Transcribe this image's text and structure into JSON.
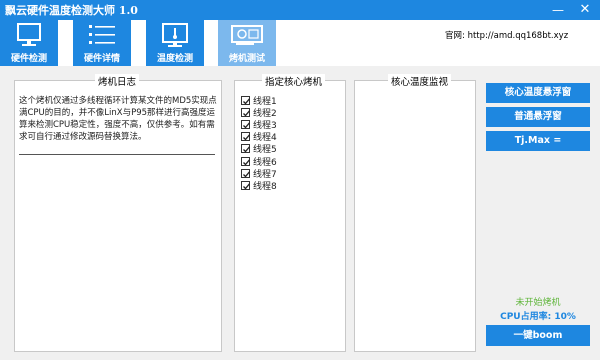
{
  "app": {
    "title": "飘云硬件温度检测大师 1.0",
    "minimize": "—",
    "close": "✕"
  },
  "tabs": [
    {
      "label": "硬件检测",
      "icon": "monitor-icon"
    },
    {
      "label": "硬件详情",
      "icon": "list-icon"
    },
    {
      "label": "温度检测",
      "icon": "thermometer-icon"
    },
    {
      "label": "烤机测试",
      "icon": "gpu-card-icon"
    }
  ],
  "website": "官网: http://amd.qq168bt.xyz",
  "log_panel": {
    "title": "烤机日志",
    "text": "这个烤机仅通过多线程循环计算某文件的MD5实现点满CPU的目的，并不像LinX与P95那样进行高强度运算来检测CPU稳定性，强度不高，仅供参考。如有需求可自行通过修改源码替换算法。"
  },
  "thread_panel": {
    "title": "指定核心烤机",
    "threads": [
      {
        "label": "线程1",
        "checked": true
      },
      {
        "label": "线程2",
        "checked": true
      },
      {
        "label": "线程3",
        "checked": true
      },
      {
        "label": "线程4",
        "checked": true
      },
      {
        "label": "线程5",
        "checked": true
      },
      {
        "label": "线程6",
        "checked": true
      },
      {
        "label": "线程7",
        "checked": true
      },
      {
        "label": "线程8",
        "checked": true
      }
    ]
  },
  "temp_panel": {
    "title": "核心温度监视"
  },
  "buttons": {
    "core_float": "核心温度悬浮窗",
    "normal_float": "普通悬浮窗",
    "tjmax": "Tj.Max =",
    "onekey": "一键boom"
  },
  "status": {
    "state": "未开始烤机",
    "cpu_usage": "CPU占用率: 10%"
  },
  "colors": {
    "accent": "#1e87e0",
    "active_tab": "#7cb8ed",
    "status_green": "#5fb53a"
  }
}
